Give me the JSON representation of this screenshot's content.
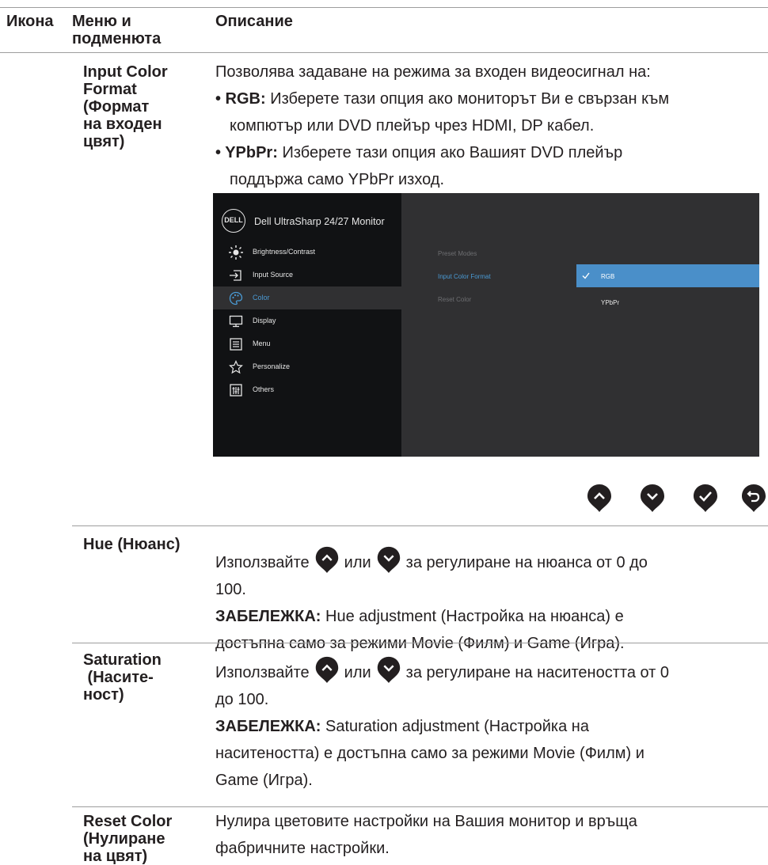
{
  "table": {
    "headers": {
      "icon": "Икона",
      "menu_line1": "Меню и",
      "menu_line2": "подменюта",
      "description": "Описание"
    }
  },
  "input_color_format": {
    "label_lines": [
      "Input Color",
      "Format",
      "(Формат",
      "на входен",
      "цвят)"
    ],
    "intro": "Позволява задаване на режима за входен видеосигнал на:",
    "rgb_bullet": "• RGB:",
    "rgb_line1": " Изберете тази опция ако мониторът Ви е свързан към",
    "rgb_line2": "компютър или DVD плейър чрез HDMI, DP кабел.",
    "ypbpr_bullet": "• YPbPr:",
    "ypbpr_line1": " Изберете тази опция ако Вашият DVD плейър",
    "ypbpr_line2": "поддържа само YPbPr изход."
  },
  "osd": {
    "logo": "DELL",
    "title": "Dell UltraSharp 24/27 Monitor",
    "menu_items": [
      {
        "label": "Brightness/Contrast",
        "icon": "brightness-icon"
      },
      {
        "label": "Input Source",
        "icon": "input-source-icon"
      },
      {
        "label": "Color",
        "icon": "color-palette-icon"
      },
      {
        "label": "Display",
        "icon": "display-icon"
      },
      {
        "label": "Menu",
        "icon": "menu-icon"
      },
      {
        "label": "Personalize",
        "icon": "star-icon"
      },
      {
        "label": "Others",
        "icon": "others-icon"
      }
    ],
    "selected_menu": "Color",
    "submenu": [
      "Preset Modes",
      "Input Color Format",
      "Reset Color"
    ],
    "active_submenu": "Input Color Format",
    "options": [
      "RGB",
      "YPbPr"
    ],
    "selected_option": "RGB",
    "colors": {
      "background": "#111214",
      "panel": "#303032",
      "highlight": "#4a8fc9"
    }
  },
  "nav_buttons": [
    "up-button-icon",
    "down-button-icon",
    "check-button-icon",
    "back-button-icon"
  ],
  "hue": {
    "label": "Hue (Нюанс)",
    "use": "Използвайте",
    "or": "или",
    "rest_line1": "за регулиране на нюанса от 0 до",
    "line2": "100.",
    "note_label": "ЗАБЕЛЕЖКА:",
    "note_line1": " Hue adjustment (Настройка на нюанса) е",
    "note_line2": "достъпна само за режими Movie (Филм) и Game (Игра)."
  },
  "saturation": {
    "label_lines": [
      "Saturation",
      " (Насите-",
      "ност)"
    ],
    "use": "Използвайте",
    "or": "или",
    "rest_line1": "за регулиране на наситеността от 0",
    "line2": "до 100.",
    "note_label": "ЗАБЕЛЕЖКА:",
    "note_line1": " Saturation adjustment (Настройка на",
    "note_line2": "наситеността) е достъпна само за режими Movie (Филм) и",
    "note_line3": "Game (Игра)."
  },
  "reset_color": {
    "label_lines": [
      "Reset Color",
      "(Нулиране",
      "на цвят)"
    ],
    "line1": "Нулира цветовите настройки на Вашия монитор и връща",
    "line2": "фабричните настройки."
  }
}
